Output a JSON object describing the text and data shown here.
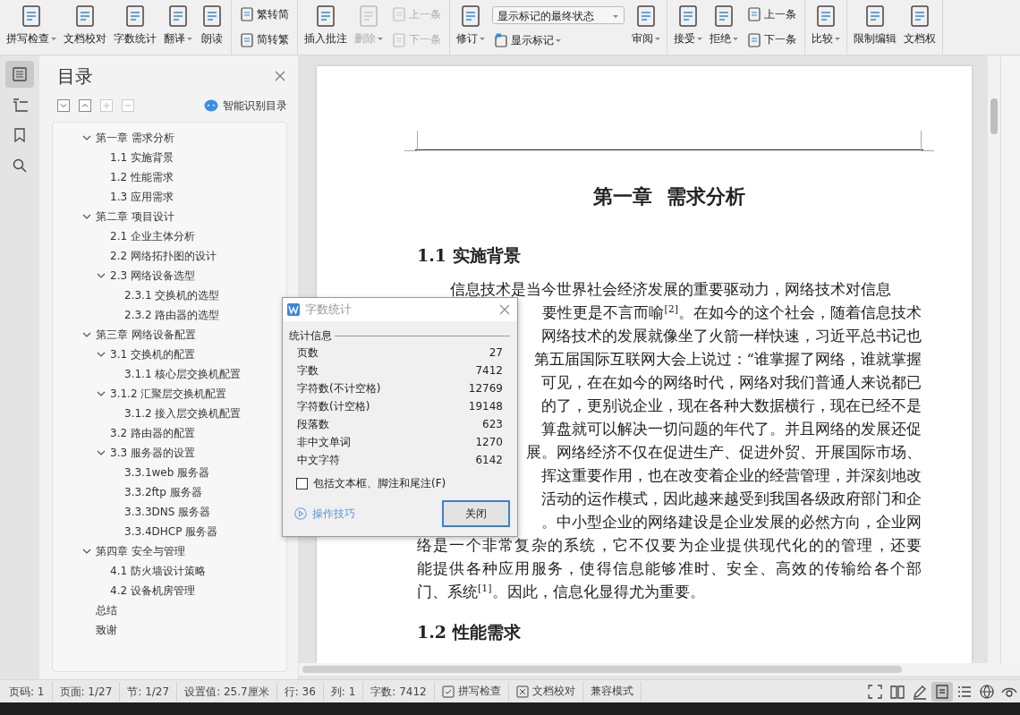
{
  "toolbar": {
    "groups": [
      {
        "columns": [
          {
            "kind": "large",
            "label": "拼写检查",
            "dropdown": true,
            "disabled": false
          },
          {
            "kind": "large",
            "label": "文档校对",
            "dropdown": false,
            "disabled": false
          },
          {
            "kind": "large",
            "label": "字数统计",
            "dropdown": false,
            "disabled": false
          },
          {
            "kind": "large",
            "label": "翻译",
            "dropdown": true,
            "disabled": false
          },
          {
            "kind": "large",
            "label": "朗读",
            "dropdown": false,
            "disabled": false
          }
        ]
      },
      {
        "columns": [
          {
            "kind": "stack",
            "items": [
              {
                "label": "繁转简",
                "dropdown": false,
                "disabled": false
              },
              {
                "label": "简转繁",
                "dropdown": false,
                "disabled": false
              }
            ]
          }
        ]
      },
      {
        "columns": [
          {
            "kind": "large",
            "label": "插入批注",
            "dropdown": false,
            "disabled": false
          },
          {
            "kind": "large",
            "label": "删除",
            "dropdown": true,
            "disabled": true
          },
          {
            "kind": "stack",
            "items": [
              {
                "label": "上一条",
                "dropdown": false,
                "disabled": true
              },
              {
                "label": "下一条",
                "dropdown": false,
                "disabled": true
              }
            ]
          }
        ]
      },
      {
        "columns": [
          {
            "kind": "large",
            "label": "修订",
            "dropdown": true,
            "disabled": false
          },
          {
            "kind": "select",
            "value": "显示标记的最终状态",
            "item": {
              "label": "显示标记",
              "dropdown": true,
              "disabled": false
            }
          },
          {
            "kind": "large",
            "label": "审阅",
            "dropdown": true,
            "disabled": false
          }
        ]
      },
      {
        "columns": [
          {
            "kind": "large",
            "label": "接受",
            "dropdown": true,
            "disabled": false
          },
          {
            "kind": "large",
            "label": "拒绝",
            "dropdown": true,
            "disabled": false
          },
          {
            "kind": "stack",
            "items": [
              {
                "label": "上一条",
                "dropdown": false,
                "disabled": false
              },
              {
                "label": "下一条",
                "dropdown": false,
                "disabled": false
              }
            ]
          }
        ]
      },
      {
        "columns": [
          {
            "kind": "large",
            "label": "比较",
            "dropdown": true,
            "disabled": false
          }
        ]
      },
      {
        "columns": [
          {
            "kind": "large",
            "label": "限制编辑",
            "dropdown": false,
            "disabled": false
          },
          {
            "kind": "large",
            "label": "文档权",
            "dropdown": false,
            "disabled": false
          }
        ]
      }
    ]
  },
  "nav_icons": [
    {
      "selected": true
    },
    {
      "selected": false
    },
    {
      "selected": false
    },
    {
      "selected": false
    }
  ],
  "toc": {
    "title": "目录",
    "smart_button": "智能识别目录",
    "tree": [
      {
        "label": "第一章 需求分析",
        "expanded": true,
        "children": [
          {
            "label": "1.1 实施背景"
          },
          {
            "label": "1.2 性能需求"
          },
          {
            "label": "1.3 应用需求"
          }
        ]
      },
      {
        "label": "第二章 项目设计",
        "expanded": true,
        "children": [
          {
            "label": "2.1 企业主体分析"
          },
          {
            "label": "2.2 网络拓扑图的设计"
          },
          {
            "label": "2.3 网络设备选型",
            "expanded": true,
            "children": [
              {
                "label": "2.3.1 交换机的选型"
              },
              {
                "label": "2.3.2 路由器的选型"
              }
            ]
          }
        ]
      },
      {
        "label": "第三章 网络设备配置",
        "expanded": true,
        "children": [
          {
            "label": "3.1 交换机的配置",
            "expanded": true,
            "children": [
              {
                "label": "3.1.1 核心层交换机配置"
              }
            ]
          },
          {
            "label": "3.1.2 汇聚层交换机配置",
            "expanded": true,
            "children": [
              {
                "label": "3.1.2 接入层交换机配置"
              }
            ]
          },
          {
            "label": "3.2 路由器的配置"
          },
          {
            "label": "3.3 服务器的设置",
            "expanded": true,
            "children": [
              {
                "label": "3.3.1web 服务器"
              },
              {
                "label": "3.3.2ftp 服务器"
              },
              {
                "label": "3.3.3DNS 服务器"
              },
              {
                "label": "3.3.4DHCP 服务器"
              }
            ]
          }
        ]
      },
      {
        "label": "第四章 安全与管理",
        "expanded": true,
        "children": [
          {
            "label": "4.1 防火墙设计策略"
          },
          {
            "label": "4.2 设备机房管理"
          }
        ]
      },
      {
        "label": "总结"
      },
      {
        "label": "致谢"
      }
    ]
  },
  "document": {
    "chapter_title": "第一章  需求分析",
    "blocks": [
      {
        "kind": "heading",
        "text": "1.1 实施背景"
      },
      {
        "kind": "first",
        "text": "信息技术是当今世界社会经济发展的重要驱动力，网络技术对信息"
      },
      {
        "kind": "covered",
        "text": "要性更是不言而喻$^{[2]}$。在如今的这个社会，随着信息技术"
      },
      {
        "kind": "covered",
        "text": "网络技术的发展就像坐了火箭一样快速，习近平总书记也"
      },
      {
        "kind": "covered",
        "text": "第五届国际互联网大会上说过：“谁掌握了网络，谁就掌握"
      },
      {
        "kind": "covered",
        "text": "可见，在在如今的网络时代，网络对我们普通人来说都已"
      },
      {
        "kind": "covered",
        "text": "的了，更别说企业，现在各种大数据横行，现在已经不是"
      },
      {
        "kind": "covered",
        "text": "算盘就可以解决一切问题的年代了。并且网络的发展还促"
      },
      {
        "kind": "covered",
        "text": "展。网络经济不仅在促进生产、促进外贸、开展国际市场、"
      },
      {
        "kind": "covered",
        "text": "挥这重要作用，也在改变着企业的经营管理，并深刻地改"
      },
      {
        "kind": "covered",
        "text": "活动的运作模式，因此越来越受到我国各级政府部门和企"
      },
      {
        "kind": "covered",
        "text": "。中小型企业的网络建设是企业发展的必然方向，企业网"
      },
      {
        "kind": "full",
        "text": "络是一个非常复杂的系统，它不仅要为企业提供现代化的的管理，还要"
      },
      {
        "kind": "full",
        "text": "能提供各种应用服务，使得信息能够准时、安全、高效的传输给各个部"
      },
      {
        "kind": "last",
        "text": "门、系统$^{[1]}$。因此，信息化显得尤为重要。"
      },
      {
        "kind": "heading",
        "text": "1.2 性能需求"
      }
    ]
  },
  "dialog": {
    "title": "字数统计",
    "section": "统计信息",
    "rows": [
      {
        "label": "页数",
        "value": "27"
      },
      {
        "label": "字数",
        "value": "7412"
      },
      {
        "label": "字符数(不计空格)",
        "value": "12769"
      },
      {
        "label": "字符数(计空格)",
        "value": "19148"
      },
      {
        "label": "段落数",
        "value": "623"
      },
      {
        "label": "非中文单词",
        "value": "1270"
      },
      {
        "label": "中文字符",
        "value": "6142"
      }
    ],
    "checkbox": {
      "label": "包括文本框、脚注和尾注(F)",
      "checked": false
    },
    "tips_link": "操作技巧",
    "close_button": "关闭"
  },
  "status_bar": {
    "fields": [
      "页码: 1",
      "页面: 1/27",
      "节: 1/27",
      "设置值: 25.7厘米",
      "行: 36",
      "列: 1",
      "字数: 7412"
    ],
    "toggles": [
      {
        "label": "拼写检查",
        "kind": "spell"
      },
      {
        "label": "文档校对",
        "kind": "proof"
      },
      {
        "label": "兼容模式",
        "kind": "plain"
      }
    ],
    "views": [
      {
        "selected": false
      },
      {
        "selected": false
      },
      {
        "selected": false
      },
      {
        "selected": true
      },
      {
        "selected": false
      },
      {
        "selected": false
      },
      {
        "selected": false
      }
    ]
  }
}
